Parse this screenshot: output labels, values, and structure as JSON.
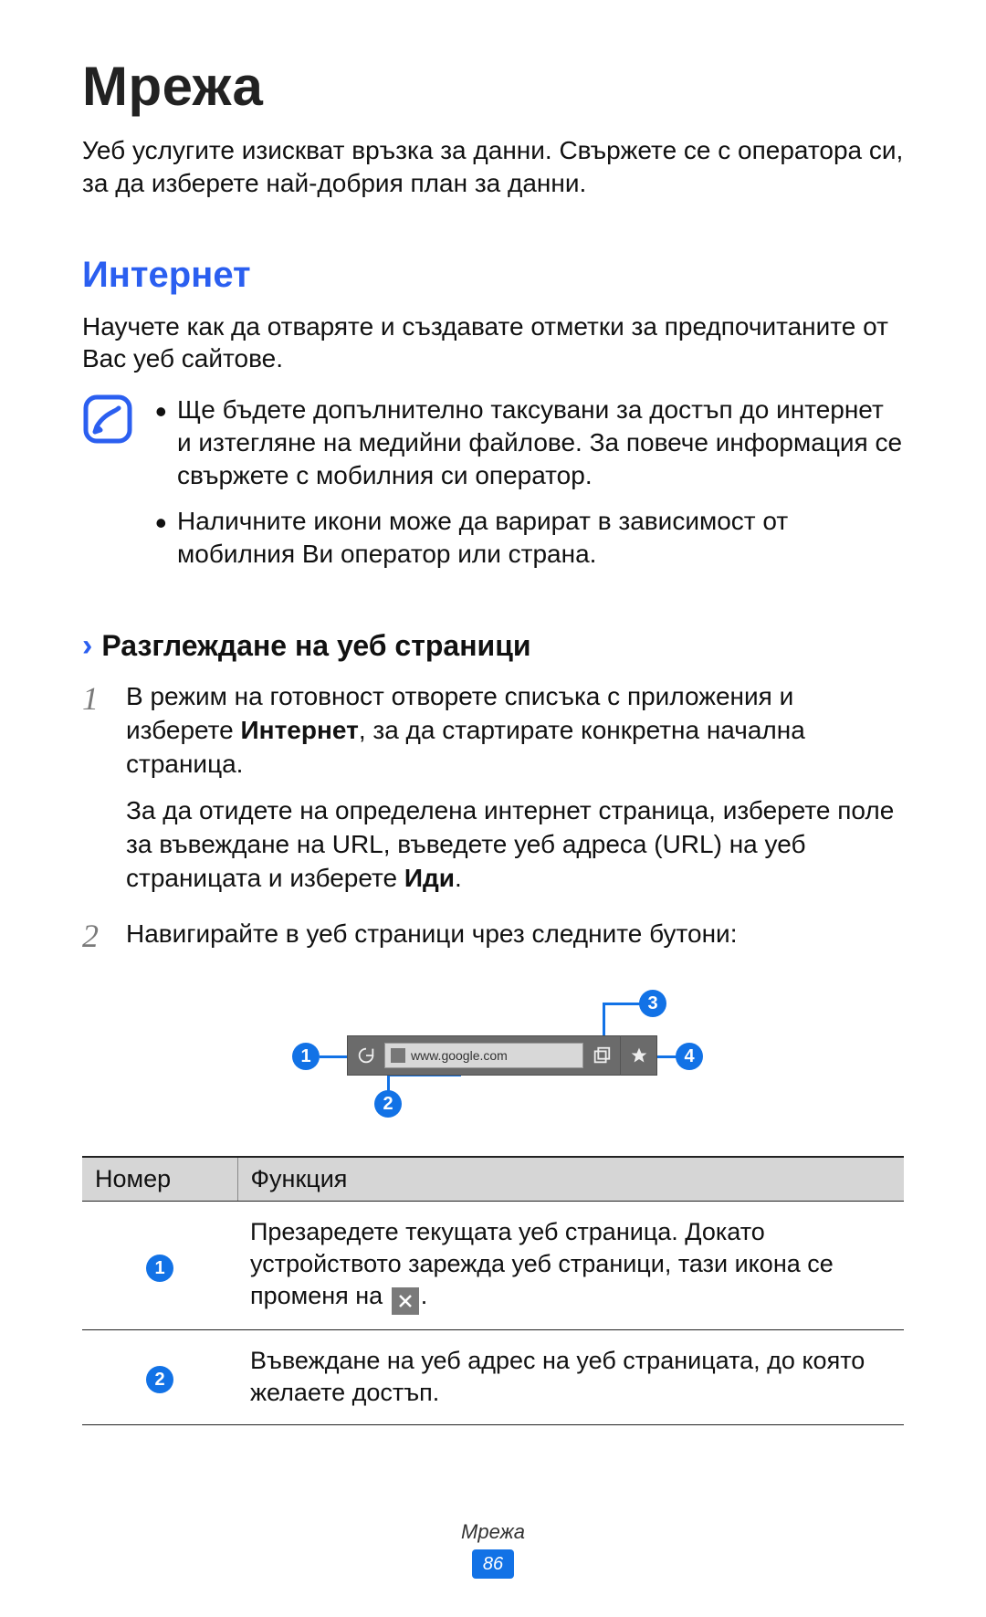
{
  "page_title": "Мрежа",
  "intro": "Уеб услугите изискват връзка за данни. Свържете се с оператора си, за да изберете най-добрия план за данни.",
  "section_internet": {
    "heading": "Интернет",
    "lead": "Научете как да отваряте и създавате отметки за предпочитаните от Вас уеб сайтове.",
    "notes": [
      "Ще бъдете допълнително таксувани за достъп до интернет и изтегляне на медийни файлове. За повече информация се свържете с мобилния си оператор.",
      "Наличните икони може да варират в зависимост от мобилния Ви оператор или страна."
    ]
  },
  "subsection_browse": {
    "chevron": "›",
    "heading": "Разглеждане на уеб страници",
    "steps": {
      "1": {
        "num": "1",
        "p1_pre": "В режим на готовност отворете списъка с приложения и изберете ",
        "p1_bold": "Интернет",
        "p1_post": ", за да стартирате конкретна начална страница.",
        "p2_pre": "За да отидете на определена интернет страница, изберете поле за въвеждане на URL, въведете уеб адреса (URL) на уеб страницата и изберете ",
        "p2_bold": "Иди",
        "p2_post": "."
      },
      "2": {
        "num": "2",
        "text": "Навигирайте в уеб страници чрез следните бутони:"
      }
    }
  },
  "diagram": {
    "url_text": "www.google.com",
    "badges": {
      "1": "1",
      "2": "2",
      "3": "3",
      "4": "4"
    }
  },
  "table": {
    "headers": {
      "number": "Номер",
      "function": "Функция"
    },
    "rows": [
      {
        "badge": "1",
        "text_pre": "Презаредете текущата уеб страница. Докато устройството зарежда уеб страници, тази икона се променя на ",
        "text_post": "."
      },
      {
        "badge": "2",
        "text": "Въвеждане на уеб адрес на уеб страницата, до която желаете достъп."
      }
    ]
  },
  "footer": {
    "title": "Мрежа",
    "page_number": "86"
  }
}
